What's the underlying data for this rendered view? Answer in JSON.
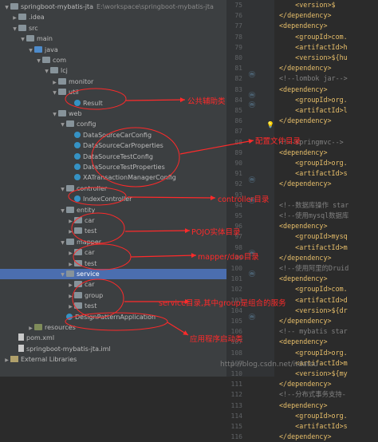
{
  "project_tree": {
    "rows": [
      {
        "label": "springboot-mybatis-jta",
        "path": "E:\\workspace\\springboot-mybatis-jta",
        "icon": "folder-icon",
        "expanded": true
      },
      {
        "label": ".idea",
        "icon": "folder-icon",
        "expanded": false
      },
      {
        "label": "src",
        "icon": "folder-icon",
        "expanded": true
      },
      {
        "label": "main",
        "icon": "folder-icon",
        "expanded": true
      },
      {
        "label": "java",
        "icon": "source-folder-icon",
        "expanded": true
      },
      {
        "label": "com",
        "icon": "package-icon",
        "expanded": true
      },
      {
        "label": "lcj",
        "icon": "package-icon",
        "expanded": true
      },
      {
        "label": "monitor",
        "icon": "package-icon",
        "expanded": false
      },
      {
        "label": "util",
        "icon": "package-icon",
        "expanded": true
      },
      {
        "label": "Result",
        "icon": "class-icon"
      },
      {
        "label": "web",
        "icon": "package-icon",
        "expanded": true
      },
      {
        "label": "config",
        "icon": "package-icon",
        "expanded": true
      },
      {
        "label": "DataSourceCarConfig",
        "icon": "class-icon"
      },
      {
        "label": "DataSourceCarProperties",
        "icon": "class-icon"
      },
      {
        "label": "DataSourceTestConfig",
        "icon": "class-icon"
      },
      {
        "label": "DataSourceTestProperties",
        "icon": "class-icon"
      },
      {
        "label": "XATransactionManagerConfig",
        "icon": "class-icon"
      },
      {
        "label": "controller",
        "icon": "package-icon",
        "expanded": true
      },
      {
        "label": "IndexController",
        "icon": "class-icon"
      },
      {
        "label": "entity",
        "icon": "package-icon",
        "expanded": true
      },
      {
        "label": "car",
        "icon": "package-icon",
        "expanded": false
      },
      {
        "label": "test",
        "icon": "package-icon",
        "expanded": false
      },
      {
        "label": "mapper",
        "icon": "package-icon",
        "expanded": true
      },
      {
        "label": "car",
        "icon": "package-icon",
        "expanded": false
      },
      {
        "label": "test",
        "icon": "package-icon",
        "expanded": false
      },
      {
        "label": "service",
        "icon": "package-icon",
        "expanded": true,
        "selected": true
      },
      {
        "label": "car",
        "icon": "package-icon",
        "expanded": false
      },
      {
        "label": "group",
        "icon": "package-icon",
        "expanded": false
      },
      {
        "label": "test",
        "icon": "package-icon",
        "expanded": false
      },
      {
        "label": "DesignPatternApplication",
        "icon": "class-icon"
      },
      {
        "label": "resources",
        "icon": "resources-folder-icon",
        "expanded": false
      },
      {
        "label": "pom.xml",
        "icon": "file-icon"
      },
      {
        "label": "springboot-mybatis-jta.iml",
        "icon": "file-icon"
      },
      {
        "label": "External Libraries",
        "icon": "library-icon",
        "expanded": false
      }
    ]
  },
  "editor": {
    "line_numbers": [
      "75",
      "76",
      "77",
      "78",
      "79",
      "80",
      "81",
      "82",
      "83",
      "84",
      "85",
      "86",
      "87",
      "88",
      "89",
      "90",
      "91",
      "92",
      "93",
      "94",
      "95",
      "96",
      "97",
      "98",
      "99",
      "100",
      "101",
      "102",
      "103",
      "104",
      "105",
      "106",
      "107",
      "108",
      "109",
      "110",
      "111",
      "112",
      "113",
      "114",
      "115",
      "116"
    ],
    "lines": [
      {
        "text": "    <version>$",
        "kind": "tag"
      },
      {
        "text": "</dependency>",
        "kind": "tag"
      },
      {
        "text": "<dependency>",
        "kind": "tag"
      },
      {
        "text": "    <groupId>com.",
        "kind": "tag"
      },
      {
        "text": "    <artifactId>h",
        "kind": "tag"
      },
      {
        "text": "    <version>${hu",
        "kind": "tag"
      },
      {
        "text": "</dependency>",
        "kind": "tag"
      },
      {
        "text": "<!--lombok jar-->",
        "kind": "comment"
      },
      {
        "text": "<dependency>",
        "kind": "tag"
      },
      {
        "text": "    <groupId>org.",
        "kind": "tag"
      },
      {
        "text": "    <artifactId>l",
        "kind": "tag"
      },
      {
        "text": "</dependency>",
        "kind": "tag"
      },
      {
        "text": "",
        "kind": "text"
      },
      {
        "text": "<!--springmvc-->",
        "kind": "comment"
      },
      {
        "text": "<dependency>",
        "kind": "tag"
      },
      {
        "text": "    <groupId>org.",
        "kind": "tag"
      },
      {
        "text": "    <artifactId>s",
        "kind": "tag"
      },
      {
        "text": "</dependency>",
        "kind": "tag"
      },
      {
        "text": "",
        "kind": "text"
      },
      {
        "text": "<!--数据库操作 star",
        "kind": "comment"
      },
      {
        "text": "<!--使用mysql数据库",
        "kind": "comment"
      },
      {
        "text": "<dependency>",
        "kind": "tag"
      },
      {
        "text": "    <groupId>mysq",
        "kind": "tag"
      },
      {
        "text": "    <artifactId>m",
        "kind": "tag"
      },
      {
        "text": "</dependency>",
        "kind": "tag"
      },
      {
        "text": "<!--使用阿里的Druid",
        "kind": "comment"
      },
      {
        "text": "<dependency>",
        "kind": "tag"
      },
      {
        "text": "    <groupId>com.",
        "kind": "tag"
      },
      {
        "text": "    <artifactId>d",
        "kind": "tag"
      },
      {
        "text": "    <version>${dr",
        "kind": "tag"
      },
      {
        "text": "</dependency>",
        "kind": "tag"
      },
      {
        "text": "<!-- mybatis star",
        "kind": "comment"
      },
      {
        "text": "<dependency>",
        "kind": "tag"
      },
      {
        "text": "    <groupId>org.",
        "kind": "tag"
      },
      {
        "text": "    <artifactId>m",
        "kind": "tag"
      },
      {
        "text": "    <version>${my",
        "kind": "tag"
      },
      {
        "text": "</dependency>",
        "kind": "tag"
      },
      {
        "text": "<!--分布式事务支持-",
        "kind": "comment"
      },
      {
        "text": "<dependency>",
        "kind": "tag"
      },
      {
        "text": "    <groupId>org.",
        "kind": "tag"
      },
      {
        "text": "    <artifactId>s",
        "kind": "tag"
      },
      {
        "text": "</dependency>",
        "kind": "tag"
      }
    ]
  },
  "annotations": [
    {
      "text": "公共辅助类"
    },
    {
      "text": "配置文件目录"
    },
    {
      "text": "controller目录"
    },
    {
      "text": "POJO实体目录"
    },
    {
      "text": "mapper/dao目录"
    },
    {
      "text": "service目录,其中group是组合的服务"
    },
    {
      "text": "应用程序启动类"
    }
  ],
  "watermark": "http://blog.csdn.net/itdatsu",
  "colors": {
    "annotation": "#ff2a2a",
    "selection": "#4b6eaf",
    "tag": "#e8bf6a",
    "comment": "#808080"
  }
}
